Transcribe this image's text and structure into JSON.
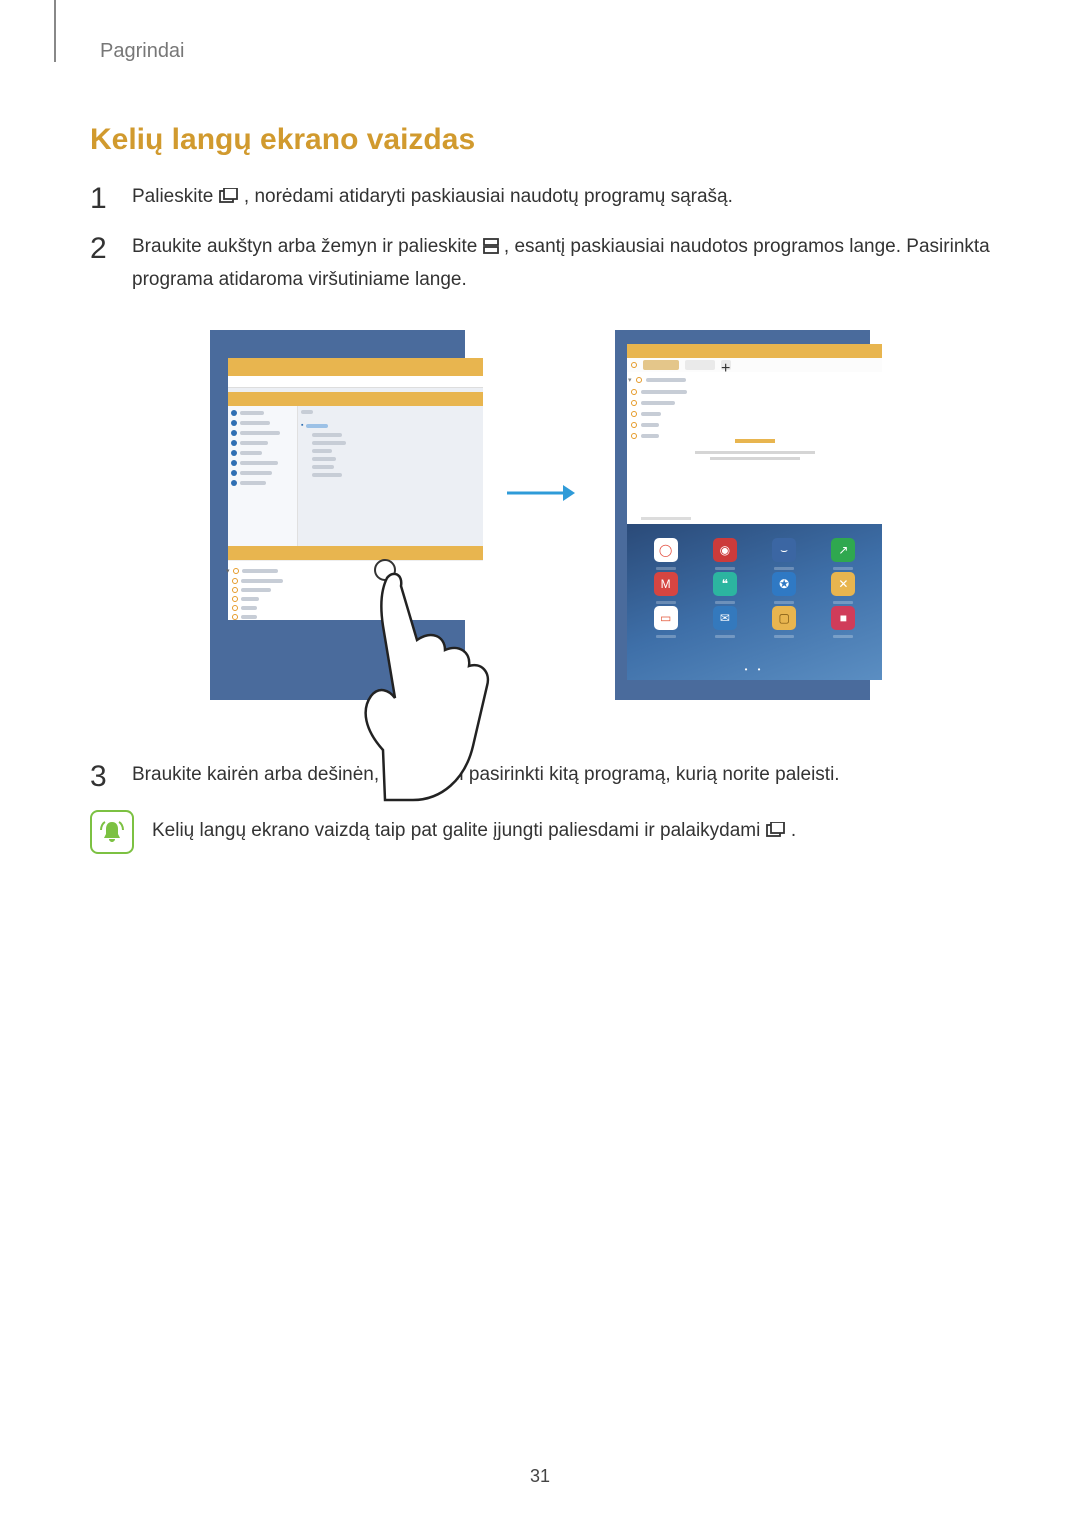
{
  "breadcrumb": "Pagrindai",
  "section_title": "Kelių langų ekrano vaizdas",
  "steps": {
    "s1": {
      "num": "1",
      "before_icon": "Palieskite ",
      "after_icon": ", norėdami atidaryti paskiausiai naudotų programų sąrašą."
    },
    "s2": {
      "num": "2",
      "before_icon": "Braukite aukštyn arba žemyn ir palieskite ",
      "after_icon": ", esantį paskiausiai naudotos programos lange. Pasirinkta programa atidaroma viršutiniame lange."
    },
    "s3": {
      "num": "3",
      "text": "Braukite kairėn arba dešinėn, norėdami pasirinkti kitą programą, kurią norite paleisti."
    }
  },
  "tip": {
    "before_icon": "Kelių langų ekrano vaizdą taip pat galite įjungti paliesdami ir palaikydami ",
    "after_icon": "."
  },
  "page_number": "31",
  "apps": [
    {
      "bg": "#ffffff",
      "fg": "#e34b3d",
      "glyph": "◯"
    },
    {
      "bg": "#cc3b3b",
      "fg": "#ffffff",
      "glyph": "◉"
    },
    {
      "bg": "#3b66a3",
      "fg": "#ffffff",
      "glyph": "⌣"
    },
    {
      "bg": "#2fa84f",
      "fg": "#ffffff",
      "glyph": "↗"
    },
    {
      "bg": "#d64541",
      "fg": "#ffffff",
      "glyph": "M"
    },
    {
      "bg": "#2cb5a0",
      "fg": "#ffffff",
      "glyph": "❝"
    },
    {
      "bg": "#2f79c4",
      "fg": "#ffffff",
      "glyph": "✪"
    },
    {
      "bg": "#e8b54f",
      "fg": "#ffffff",
      "glyph": "✕"
    },
    {
      "bg": "#ffffff",
      "fg": "#e3593b",
      "glyph": "▭"
    },
    {
      "bg": "#3479bd",
      "fg": "#ffffff",
      "glyph": "✉"
    },
    {
      "bg": "#e8b54f",
      "fg": "#7a5410",
      "glyph": "▢"
    },
    {
      "bg": "#d03c5a",
      "fg": "#ffffff",
      "glyph": "■"
    }
  ]
}
